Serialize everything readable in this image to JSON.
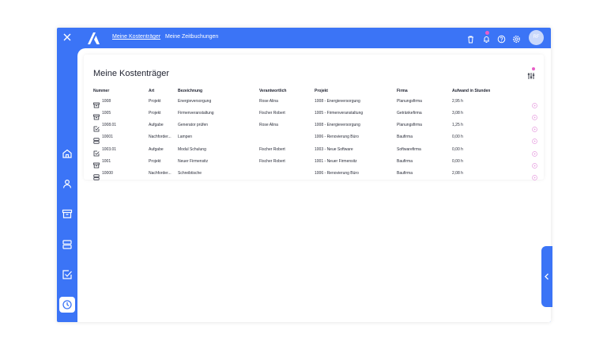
{
  "header": {
    "nav": [
      {
        "label": "Meine Kostenträger"
      },
      {
        "label": "Meine Zeitbuchungen"
      }
    ],
    "avatar_initials": "RF",
    "icons": [
      "close-icon",
      "trash-icon",
      "bell-icon",
      "help-icon",
      "gear-icon"
    ]
  },
  "sidebar": {
    "items": [
      "home-icon",
      "user-icon",
      "archive-icon",
      "server-icon",
      "checkbox-icon",
      "clock-icon"
    ],
    "active": "clock-icon"
  },
  "main": {
    "title": "Meine Kostenträger",
    "columns": [
      "Nummer",
      "Art",
      "Bezeichnung",
      "Verantwortlich",
      "Projekt",
      "Firma",
      "Aufwand in Stunden"
    ],
    "rows": [
      {
        "icon": "archive-icon",
        "nummer": "1008",
        "art": "Projekt",
        "bezeichnung": "Energieversorgung",
        "verantwortlich": "Rose Alina",
        "projekt": "1008 - Energieversorgung",
        "firma": "Planungsfirma",
        "aufwand": "2,95 h"
      },
      {
        "icon": "archive-icon",
        "nummer": "1005",
        "art": "Projekt",
        "bezeichnung": "Firmenveranstaltung",
        "verantwortlich": "Fischer Robert",
        "projekt": "1005 - Firmenveranstaltung",
        "firma": "Getränkefirma",
        "aufwand": "3,08 h"
      },
      {
        "icon": "checkbox-icon",
        "nummer": "1008.01",
        "art": "Aufgabe",
        "bezeichnung": "Generator prüfen",
        "verantwortlich": "Rose Alina",
        "projekt": "1008 - Energieversorgung",
        "firma": "Planungsfirma",
        "aufwand": "1,25 h"
      },
      {
        "icon": "server-icon",
        "nummer": "10001",
        "art": "Nachforder...",
        "bezeichnung": "Lampen",
        "verantwortlich": "",
        "projekt": "1006 - Renovierung Büro",
        "firma": "Baufirma",
        "aufwand": "0,00 h"
      },
      {
        "icon": "checkbox-icon",
        "nummer": "1003.01",
        "art": "Aufgabe",
        "bezeichnung": "Modul Schulung",
        "verantwortlich": "Fischer Robert",
        "projekt": "1003 - Neue Software",
        "firma": "Softwarefirma",
        "aufwand": "0,00 h"
      },
      {
        "icon": "archive-icon",
        "nummer": "1001",
        "art": "Projekt",
        "bezeichnung": "Neuer Firmensitz",
        "verantwortlich": "Fischer Robert",
        "projekt": "1001 - Neuer Firmensitz",
        "firma": "Baufirma",
        "aufwand": "0,00 h"
      },
      {
        "icon": "server-icon",
        "nummer": "10000",
        "art": "Nachforder...",
        "bezeichnung": "Schreibtische",
        "verantwortlich": "",
        "projekt": "1006 - Renovierung Büro",
        "firma": "Baufirma",
        "aufwand": "2,08 h"
      }
    ]
  },
  "colors": {
    "brand": "#3b74f6",
    "accent_dot": "#e85ec7",
    "row_action": "#e7a0e0"
  }
}
